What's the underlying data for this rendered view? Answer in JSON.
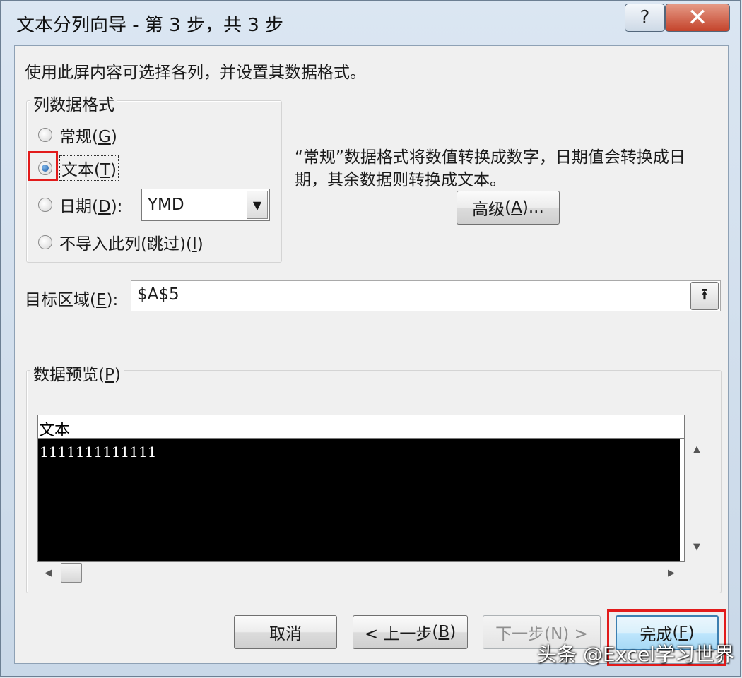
{
  "window": {
    "title": "文本分列向导 - 第 3 步，共 3 步",
    "help_label": "?",
    "close_label": "✕"
  },
  "instruction": "使用此屏内容可选择各列，并设置其数据格式。",
  "column_format": {
    "legend": "列数据格式",
    "options": [
      {
        "label": "常规",
        "mnemonic": "G",
        "checked": false
      },
      {
        "label": "文本",
        "mnemonic": "T",
        "checked": true
      },
      {
        "label": "日期",
        "mnemonic": "D",
        "checked": false
      },
      {
        "label": "不导入此列(跳过)",
        "mnemonic": "I",
        "checked": false
      }
    ],
    "date_format": {
      "value": "YMD"
    }
  },
  "description": {
    "line1": "“常规”数据格式将数值转换成数字，日期值会转换成日",
    "line2": "期，其余数据则转换成文本。"
  },
  "advanced_button": {
    "label": "高级",
    "mnemonic": "A",
    "suffix": "..."
  },
  "destination": {
    "label": "目标区域",
    "mnemonic": "E",
    "value": "$A$5",
    "button_icon": "collapse-dialog-icon"
  },
  "preview": {
    "legend": "数据预览",
    "mnemonic": "P",
    "header": "文本",
    "rows": [
      "1111111111111"
    ]
  },
  "buttons": {
    "cancel": "取消",
    "back": "< 上一步",
    "back_mnemonic": "B",
    "next": "下一步(N) >",
    "finish": "完成",
    "finish_mnemonic": "F"
  },
  "watermark": "头条 @Excel学习世界",
  "colors": {
    "highlight": "#e21b1b",
    "preview_bg": "#000000"
  }
}
